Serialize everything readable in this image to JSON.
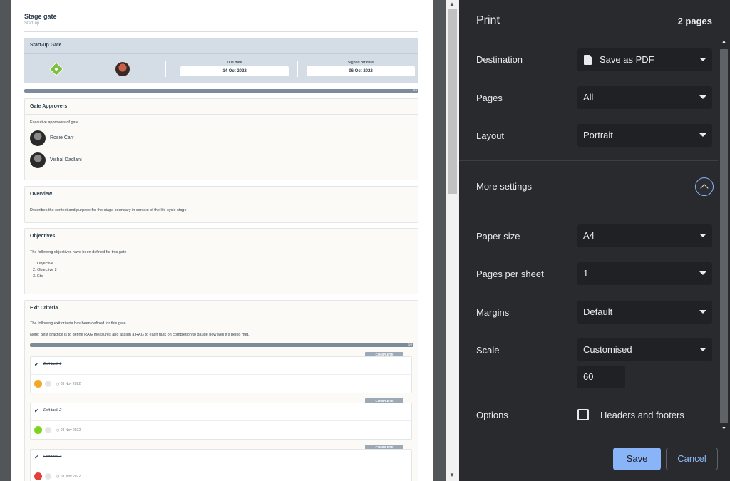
{
  "preview": {
    "doc_title": "Stage gate",
    "doc_subtitle": "Start-up",
    "gate": {
      "title": "Start-up Gate",
      "due_date_label": "Due date",
      "due_date": "14 Oct 2022",
      "signed_off_label": "Signed off date",
      "signed_off_date": "06 Oct 2022",
      "progress_label": "3/3"
    },
    "approvers": {
      "heading": "Gate Approvers",
      "description": "Executive approvers of gate.",
      "people": [
        "Rosie Carr",
        "Vishal Dadlani"
      ]
    },
    "overview": {
      "heading": "Overview",
      "text": "Describes the context and purpose for the stage boundary in context of the life cycle stage."
    },
    "objectives": {
      "heading": "Objectives",
      "intro": "The following objectives have been defined for this gate",
      "items": [
        "1. Objective 1",
        "2. Objective 2",
        "3. Etc"
      ]
    },
    "exit_criteria": {
      "heading": "Exit Criteria",
      "intro": "The following exit criteria has been defined for this gate.",
      "note": "Note: Best practice is to define RAG measures and assign a RAG to each task on completion to gauge how well it's being met.",
      "progress_label": "3/3",
      "tasks": [
        {
          "name": "Exit task 1",
          "status": "COMPLETE",
          "date": "03 Nov 2022",
          "rag_color": "#f5a623"
        },
        {
          "name": "Exit task 2",
          "status": "COMPLETE",
          "date": "03 Nov 2022",
          "rag_color": "#7ed321"
        },
        {
          "name": "Exit task 3",
          "status": "COMPLETE",
          "date": "03 Nov 2022",
          "rag_color": "#e0413a"
        }
      ]
    }
  },
  "print": {
    "title": "Print",
    "page_count": "2 pages",
    "destination_label": "Destination",
    "destination_value": "Save as PDF",
    "pages_label": "Pages",
    "pages_value": "All",
    "layout_label": "Layout",
    "layout_value": "Portrait",
    "more_settings_label": "More settings",
    "paper_size_label": "Paper size",
    "paper_size_value": "A4",
    "pages_per_sheet_label": "Pages per sheet",
    "pages_per_sheet_value": "1",
    "margins_label": "Margins",
    "margins_value": "Default",
    "scale_label": "Scale",
    "scale_value": "Customised",
    "scale_input": "60",
    "options_label": "Options",
    "headers_footers_label": "Headers and footers",
    "save_label": "Save",
    "cancel_label": "Cancel"
  },
  "colors": {
    "accent": "#8ab4f8",
    "panel_bg": "#292a2d",
    "field_bg": "#202124"
  }
}
